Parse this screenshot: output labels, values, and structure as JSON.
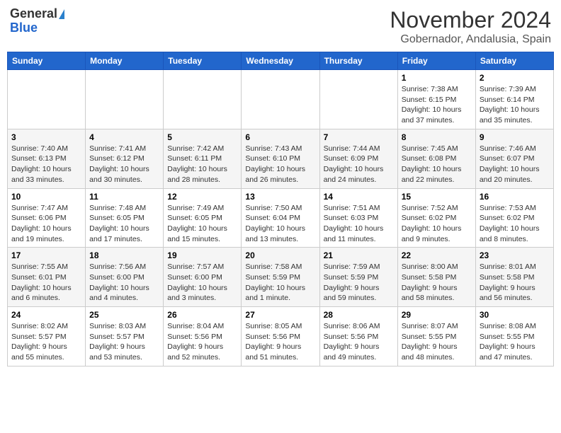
{
  "header": {
    "logo_general": "General",
    "logo_blue": "Blue",
    "month": "November 2024",
    "location": "Gobernador, Andalusia, Spain"
  },
  "columns": [
    "Sunday",
    "Monday",
    "Tuesday",
    "Wednesday",
    "Thursday",
    "Friday",
    "Saturday"
  ],
  "weeks": [
    {
      "days": [
        {
          "num": "",
          "info": ""
        },
        {
          "num": "",
          "info": ""
        },
        {
          "num": "",
          "info": ""
        },
        {
          "num": "",
          "info": ""
        },
        {
          "num": "",
          "info": ""
        },
        {
          "num": "1",
          "info": "Sunrise: 7:38 AM\nSunset: 6:15 PM\nDaylight: 10 hours and 37 minutes."
        },
        {
          "num": "2",
          "info": "Sunrise: 7:39 AM\nSunset: 6:14 PM\nDaylight: 10 hours and 35 minutes."
        }
      ]
    },
    {
      "days": [
        {
          "num": "3",
          "info": "Sunrise: 7:40 AM\nSunset: 6:13 PM\nDaylight: 10 hours and 33 minutes."
        },
        {
          "num": "4",
          "info": "Sunrise: 7:41 AM\nSunset: 6:12 PM\nDaylight: 10 hours and 30 minutes."
        },
        {
          "num": "5",
          "info": "Sunrise: 7:42 AM\nSunset: 6:11 PM\nDaylight: 10 hours and 28 minutes."
        },
        {
          "num": "6",
          "info": "Sunrise: 7:43 AM\nSunset: 6:10 PM\nDaylight: 10 hours and 26 minutes."
        },
        {
          "num": "7",
          "info": "Sunrise: 7:44 AM\nSunset: 6:09 PM\nDaylight: 10 hours and 24 minutes."
        },
        {
          "num": "8",
          "info": "Sunrise: 7:45 AM\nSunset: 6:08 PM\nDaylight: 10 hours and 22 minutes."
        },
        {
          "num": "9",
          "info": "Sunrise: 7:46 AM\nSunset: 6:07 PM\nDaylight: 10 hours and 20 minutes."
        }
      ]
    },
    {
      "days": [
        {
          "num": "10",
          "info": "Sunrise: 7:47 AM\nSunset: 6:06 PM\nDaylight: 10 hours and 19 minutes."
        },
        {
          "num": "11",
          "info": "Sunrise: 7:48 AM\nSunset: 6:05 PM\nDaylight: 10 hours and 17 minutes."
        },
        {
          "num": "12",
          "info": "Sunrise: 7:49 AM\nSunset: 6:05 PM\nDaylight: 10 hours and 15 minutes."
        },
        {
          "num": "13",
          "info": "Sunrise: 7:50 AM\nSunset: 6:04 PM\nDaylight: 10 hours and 13 minutes."
        },
        {
          "num": "14",
          "info": "Sunrise: 7:51 AM\nSunset: 6:03 PM\nDaylight: 10 hours and 11 minutes."
        },
        {
          "num": "15",
          "info": "Sunrise: 7:52 AM\nSunset: 6:02 PM\nDaylight: 10 hours and 9 minutes."
        },
        {
          "num": "16",
          "info": "Sunrise: 7:53 AM\nSunset: 6:02 PM\nDaylight: 10 hours and 8 minutes."
        }
      ]
    },
    {
      "days": [
        {
          "num": "17",
          "info": "Sunrise: 7:55 AM\nSunset: 6:01 PM\nDaylight: 10 hours and 6 minutes."
        },
        {
          "num": "18",
          "info": "Sunrise: 7:56 AM\nSunset: 6:00 PM\nDaylight: 10 hours and 4 minutes."
        },
        {
          "num": "19",
          "info": "Sunrise: 7:57 AM\nSunset: 6:00 PM\nDaylight: 10 hours and 3 minutes."
        },
        {
          "num": "20",
          "info": "Sunrise: 7:58 AM\nSunset: 5:59 PM\nDaylight: 10 hours and 1 minute."
        },
        {
          "num": "21",
          "info": "Sunrise: 7:59 AM\nSunset: 5:59 PM\nDaylight: 9 hours and 59 minutes."
        },
        {
          "num": "22",
          "info": "Sunrise: 8:00 AM\nSunset: 5:58 PM\nDaylight: 9 hours and 58 minutes."
        },
        {
          "num": "23",
          "info": "Sunrise: 8:01 AM\nSunset: 5:58 PM\nDaylight: 9 hours and 56 minutes."
        }
      ]
    },
    {
      "days": [
        {
          "num": "24",
          "info": "Sunrise: 8:02 AM\nSunset: 5:57 PM\nDaylight: 9 hours and 55 minutes."
        },
        {
          "num": "25",
          "info": "Sunrise: 8:03 AM\nSunset: 5:57 PM\nDaylight: 9 hours and 53 minutes."
        },
        {
          "num": "26",
          "info": "Sunrise: 8:04 AM\nSunset: 5:56 PM\nDaylight: 9 hours and 52 minutes."
        },
        {
          "num": "27",
          "info": "Sunrise: 8:05 AM\nSunset: 5:56 PM\nDaylight: 9 hours and 51 minutes."
        },
        {
          "num": "28",
          "info": "Sunrise: 8:06 AM\nSunset: 5:56 PM\nDaylight: 9 hours and 49 minutes."
        },
        {
          "num": "29",
          "info": "Sunrise: 8:07 AM\nSunset: 5:55 PM\nDaylight: 9 hours and 48 minutes."
        },
        {
          "num": "30",
          "info": "Sunrise: 8:08 AM\nSunset: 5:55 PM\nDaylight: 9 hours and 47 minutes."
        }
      ]
    }
  ]
}
